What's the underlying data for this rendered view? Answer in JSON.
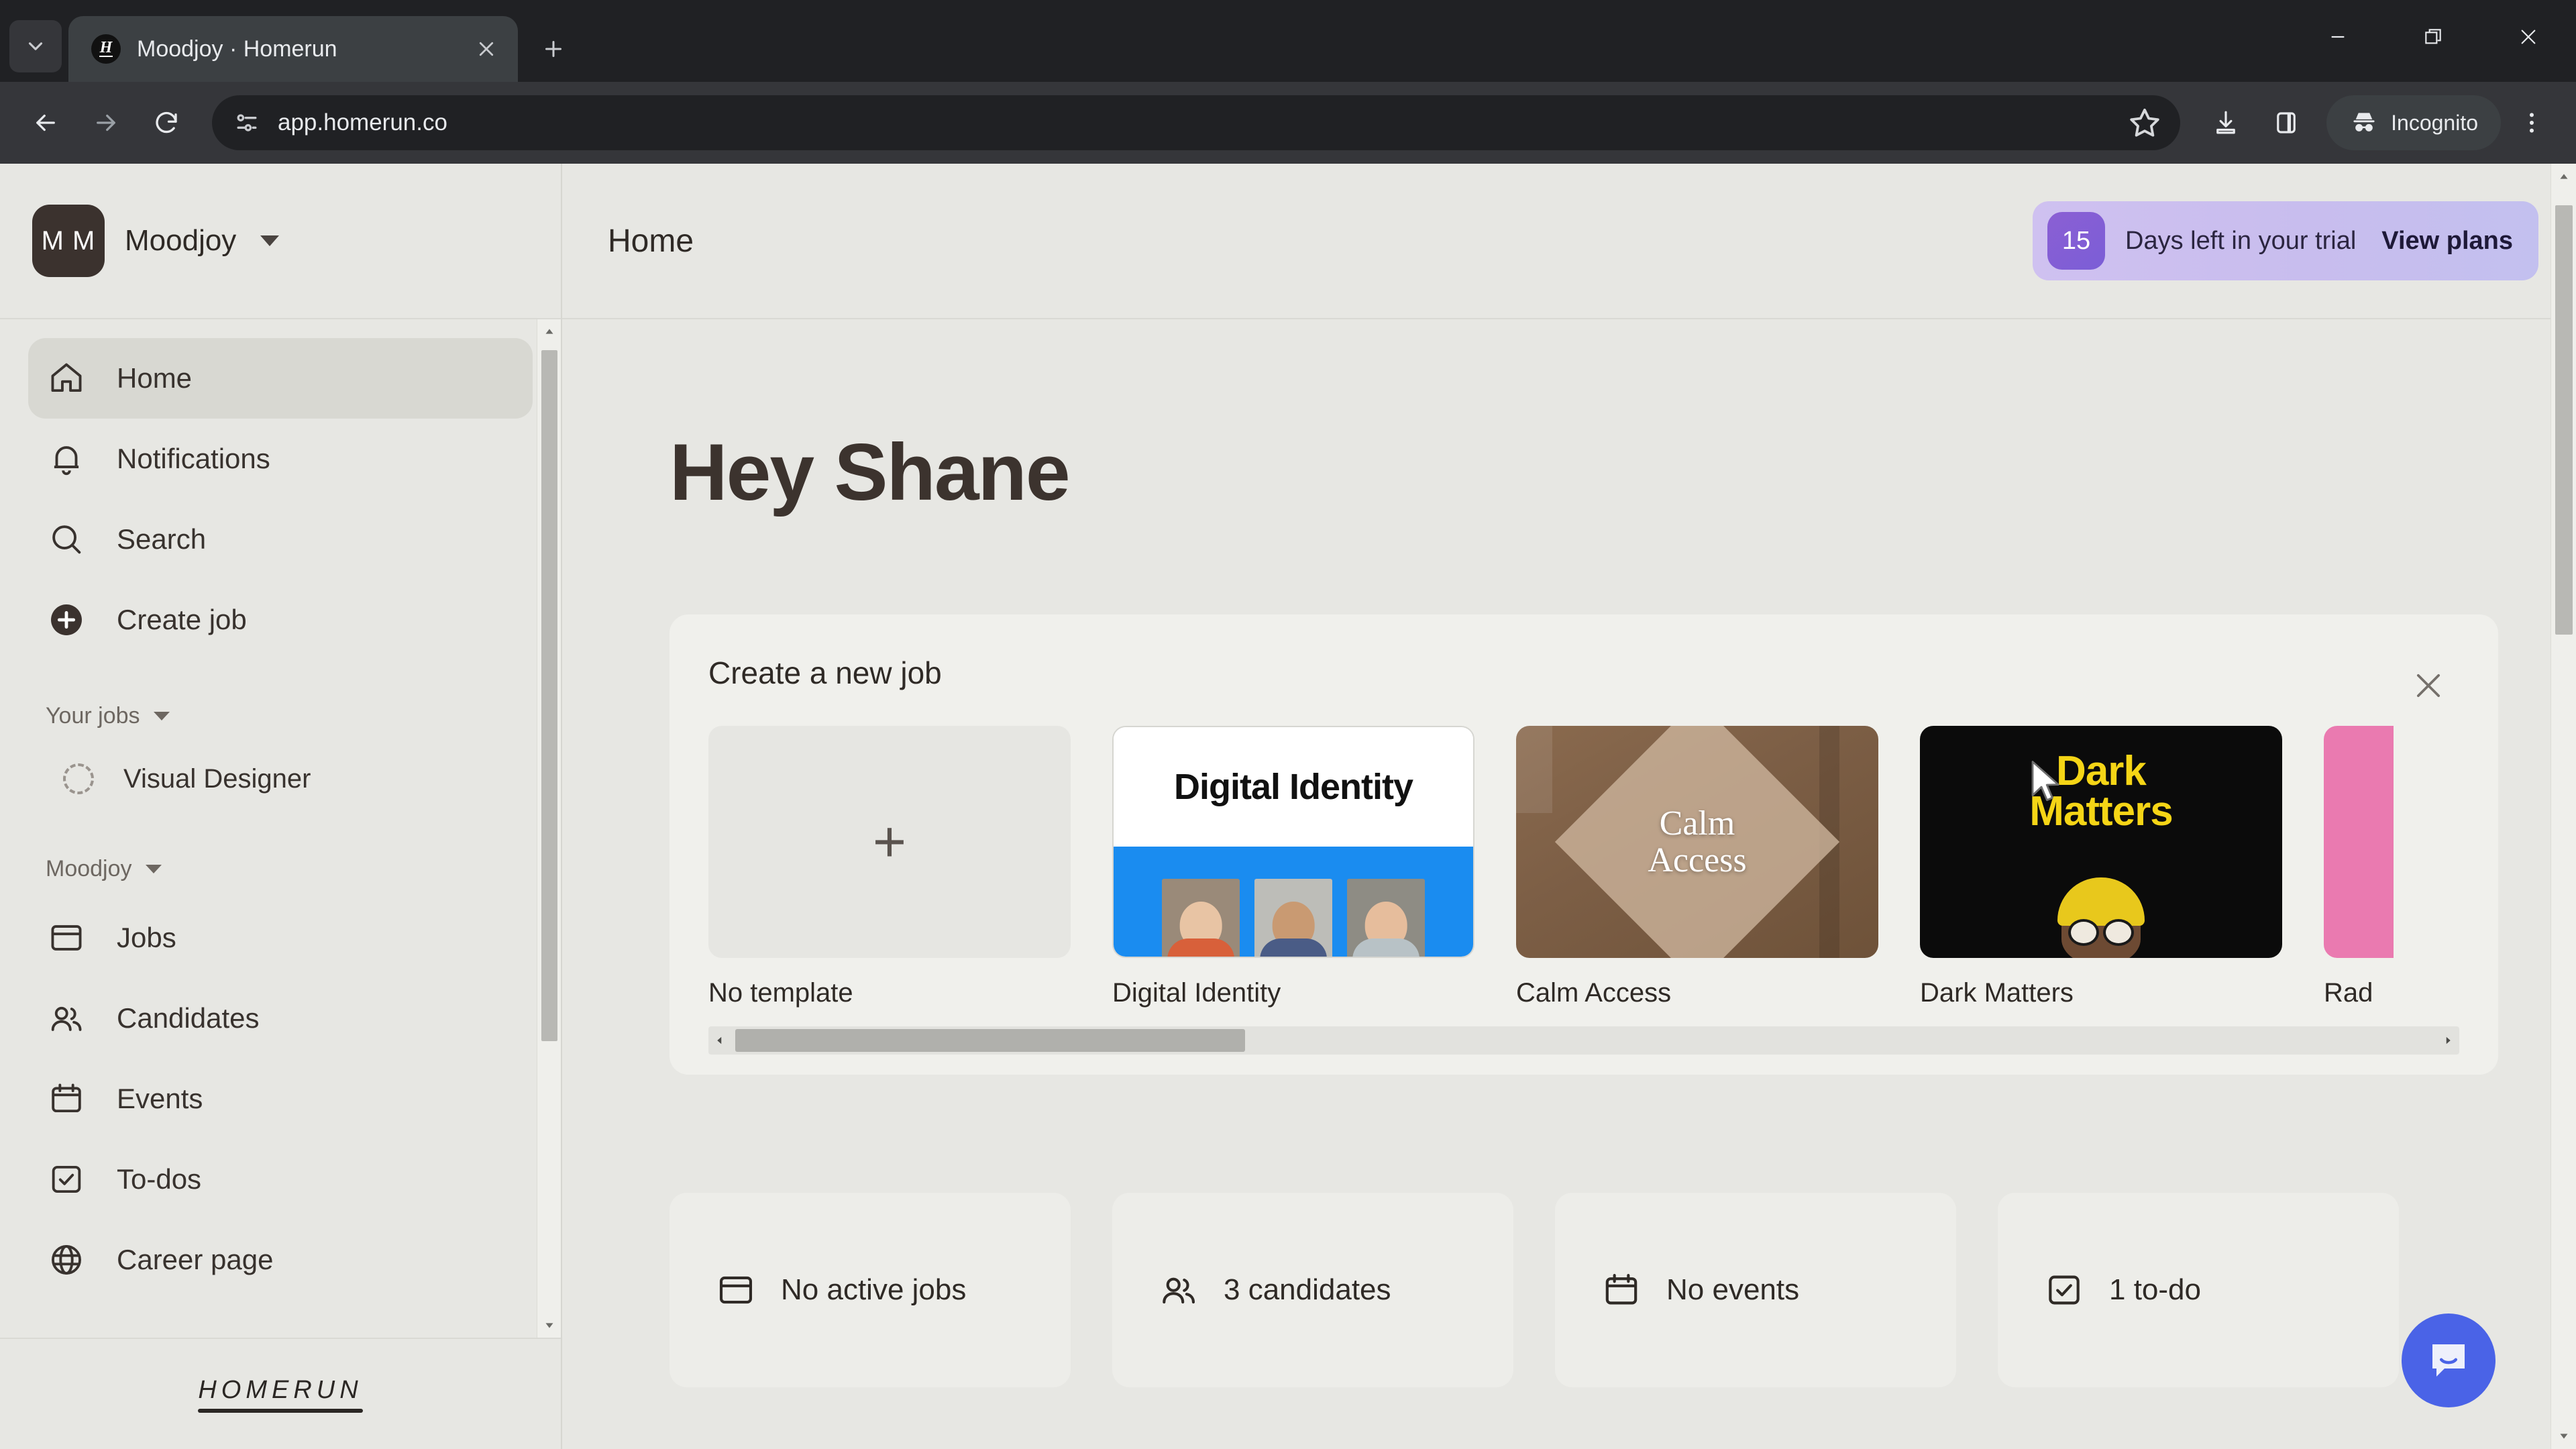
{
  "browser": {
    "tab": {
      "title": "Moodjoy · Homerun",
      "favicon_letter": "H"
    },
    "tab_search_icon": "chevron-down-icon",
    "new_tab_icon": "plus-icon",
    "window_controls": {
      "minimize": "minimize-icon",
      "maximize": "maximize-icon",
      "close": "close-icon"
    },
    "nav": {
      "back": "back-arrow-icon",
      "forward": "forward-arrow-icon",
      "reload": "reload-icon"
    },
    "omnibox": {
      "url": "app.homerun.co",
      "site_settings_icon": "site-settings-icon",
      "bookmark_icon": "star-icon"
    },
    "toolbar_icons": [
      "download-icon",
      "side-panel-icon"
    ],
    "incognito": {
      "label": "Incognito",
      "icon": "incognito-icon"
    },
    "menu_icon": "three-dots-vertical-icon"
  },
  "sidebar": {
    "workspace": {
      "initials": "M M",
      "name": "Moodjoy",
      "caret_icon": "chevron-down-icon"
    },
    "nav_items": [
      {
        "label": "Home",
        "icon": "home-icon",
        "active": true
      },
      {
        "label": "Notifications",
        "icon": "bell-icon",
        "active": false
      },
      {
        "label": "Search",
        "icon": "search-icon",
        "active": false
      },
      {
        "label": "Create job",
        "icon": "plus-circle-icon",
        "active": false
      }
    ],
    "your_jobs": {
      "title": "Your jobs",
      "caret_icon": "chevron-down-icon",
      "items": [
        {
          "label": "Visual Designer",
          "icon": "dashed-circle-icon"
        }
      ]
    },
    "workspace_group": {
      "title": "Moodjoy",
      "caret_icon": "chevron-down-icon",
      "items": [
        {
          "label": "Jobs",
          "icon": "jobs-icon"
        },
        {
          "label": "Candidates",
          "icon": "people-icon"
        },
        {
          "label": "Events",
          "icon": "calendar-icon"
        },
        {
          "label": "To-dos",
          "icon": "checkbox-icon"
        },
        {
          "label": "Career page",
          "icon": "globe-icon"
        }
      ]
    },
    "footer_logo": "HOMERUN"
  },
  "topbar": {
    "title": "Home",
    "trial": {
      "days": "15",
      "text": "Days left in your trial",
      "link": "View plans"
    }
  },
  "main": {
    "greeting": "Hey Shane",
    "create_job_card": {
      "title": "Create a new job",
      "close_icon": "close-icon",
      "templates": [
        {
          "label": "No template",
          "kind": "empty",
          "plus": "+"
        },
        {
          "label": "Digital Identity",
          "kind": "digital-identity",
          "thumb_title": "Digital Identity"
        },
        {
          "label": "Calm Access",
          "kind": "calm-access",
          "thumb_line1": "Calm",
          "thumb_line2": "Access"
        },
        {
          "label": "Dark Matters",
          "kind": "dark-matters",
          "thumb_line1": "Dark",
          "thumb_line2": "Matters"
        },
        {
          "label": "Rad",
          "kind": "radiant-clipped"
        }
      ],
      "scrollbar": {
        "left_arrow": "chevron-left-icon",
        "right_arrow": "chevron-right-icon"
      }
    },
    "stats": [
      {
        "label": "No active jobs",
        "icon": "jobs-icon"
      },
      {
        "label": "3 candidates",
        "icon": "people-icon"
      },
      {
        "label": "No events",
        "icon": "calendar-icon"
      },
      {
        "label": "1 to-do",
        "icon": "checkbox-icon"
      }
    ],
    "intercom": {
      "icon": "chat-bubble-icon"
    }
  },
  "colors": {
    "page_bg": "#e7e7e3",
    "card_bg": "#f0f0ec",
    "text": "#2f2a26",
    "browser_chrome": "#35363a",
    "browser_tabstrip": "#202124",
    "trial_accent": "#7b5ed6",
    "intercom_blue": "#4a63e7",
    "digital_identity_blue": "#1a8cf0",
    "dark_matters_yellow": "#f5d516",
    "radiant_pink": "#ea7ab0"
  }
}
